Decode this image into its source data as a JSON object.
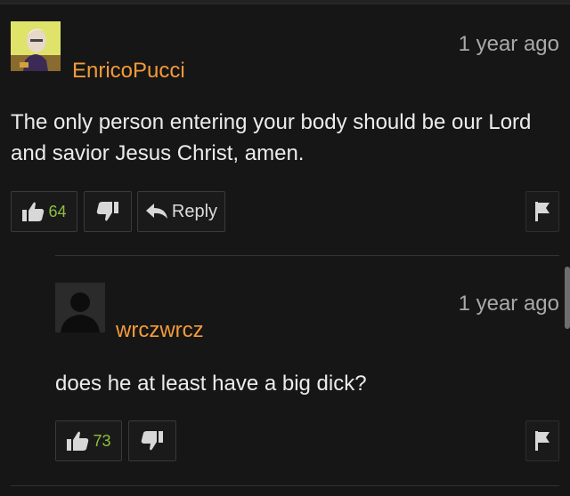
{
  "comments": [
    {
      "username": "EnricoPucci",
      "time": "1 year ago",
      "text": "The only person entering your body should be our Lord and savior Jesus Christ, amen.",
      "likes": "64",
      "reply_label": "Reply"
    },
    {
      "username": "wrczwrcz",
      "time": "1 year ago",
      "text": "does he at least have a big dick?",
      "likes": "73"
    }
  ],
  "colors": {
    "background": "#161616",
    "username": "#f39a3b",
    "like_count": "#8cbf3f",
    "timestamp": "#a9a9a9"
  },
  "icons": [
    "thumbs-up-icon",
    "thumbs-down-icon",
    "reply-arrow-icon",
    "flag-icon"
  ]
}
